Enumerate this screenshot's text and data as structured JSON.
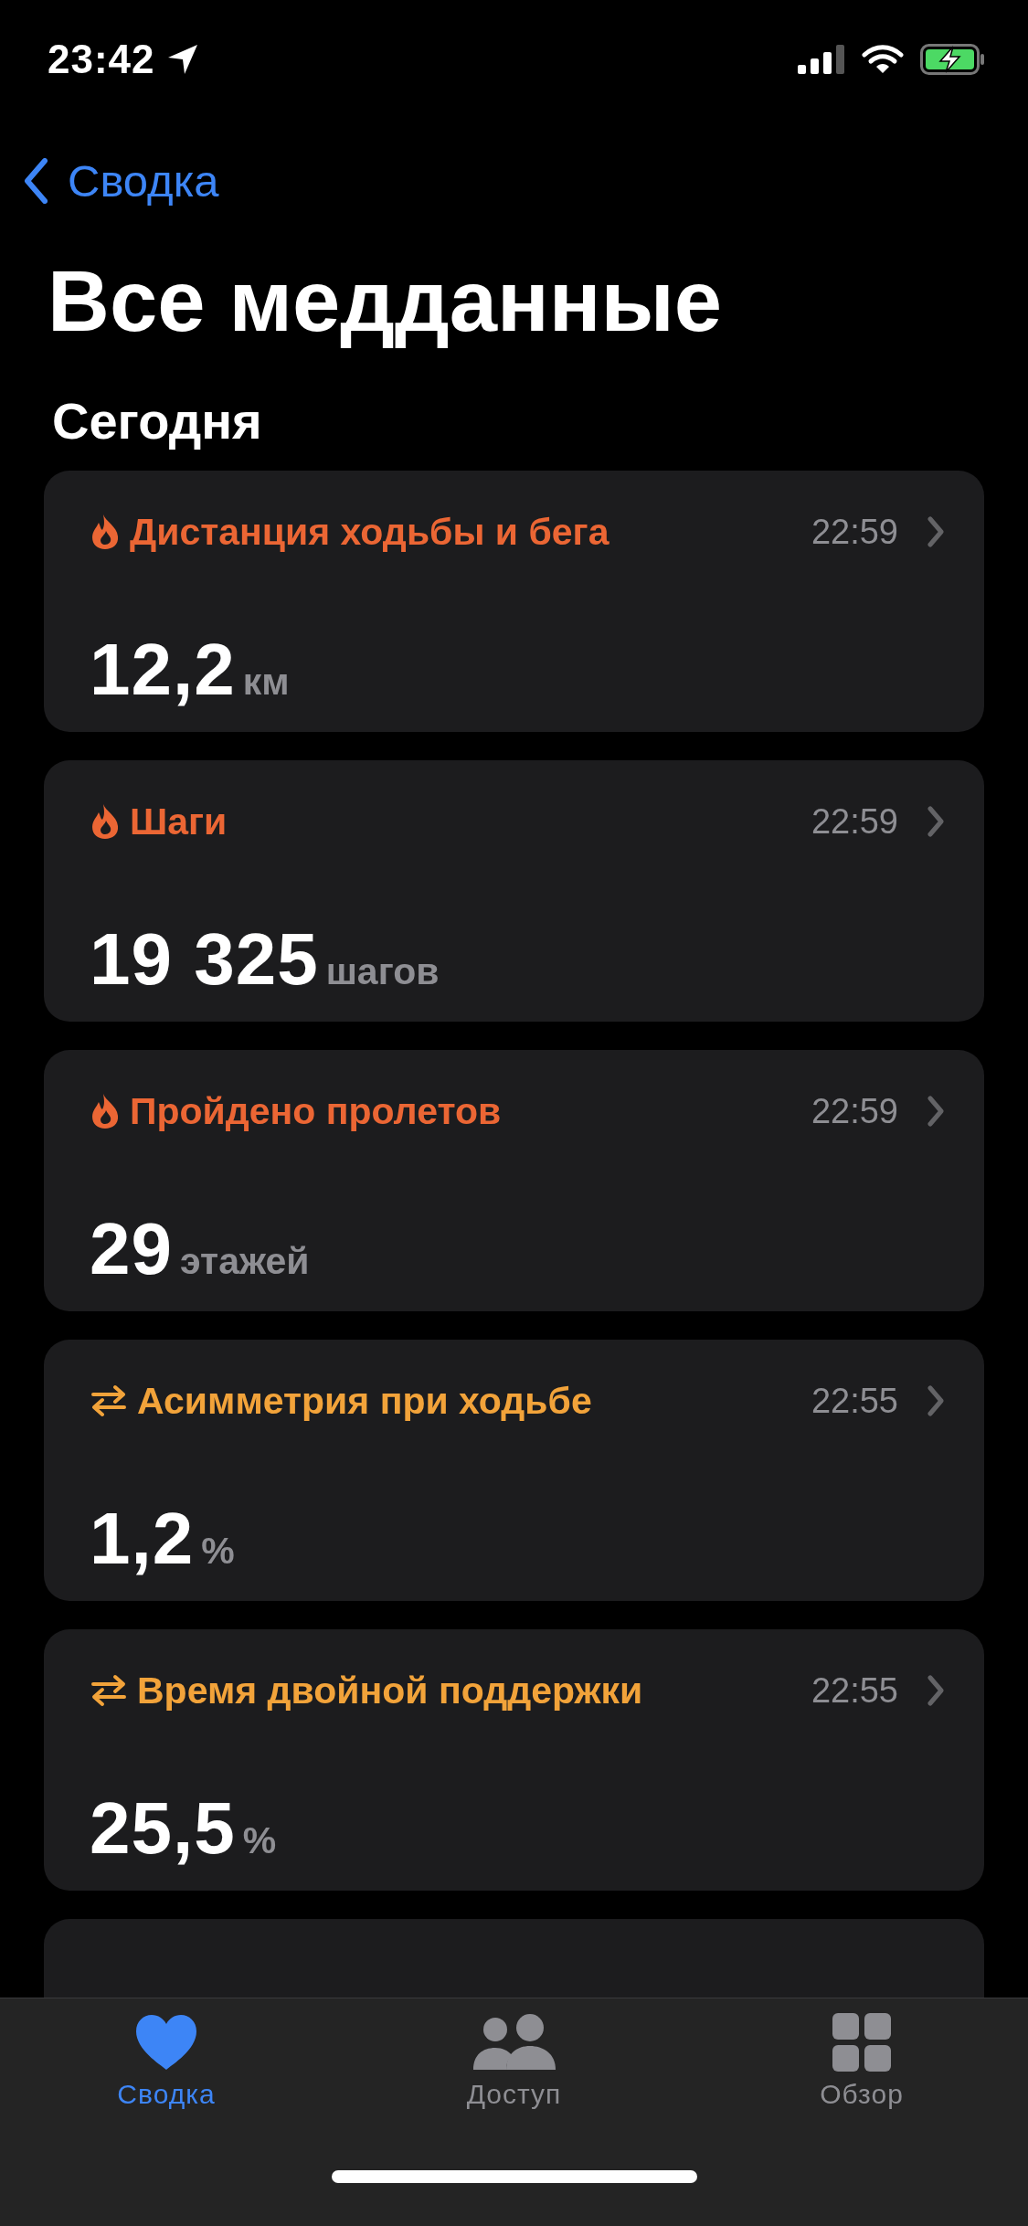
{
  "status_bar": {
    "time": "23:42"
  },
  "nav": {
    "back_label": "Сводка"
  },
  "title": "Все медданные",
  "section": "Сегодня",
  "cards": [
    {
      "kind": "activity",
      "title": "Дистанция ходьбы и бега",
      "time": "22:59",
      "value": "12,2",
      "unit": "км"
    },
    {
      "kind": "activity",
      "title": "Шаги",
      "time": "22:59",
      "value": "19 325",
      "unit": "шагов"
    },
    {
      "kind": "activity",
      "title": "Пройдено пролетов",
      "time": "22:59",
      "value": "29",
      "unit": "этажей"
    },
    {
      "kind": "mobility",
      "title": "Асимметрия при ходьбе",
      "time": "22:55",
      "value": "1,2",
      "unit": "%"
    },
    {
      "kind": "mobility",
      "title": "Время двойной поддержки",
      "time": "22:55",
      "value": "25,5",
      "unit": "%"
    }
  ],
  "tabs": [
    {
      "kind": "summary",
      "label": "Сводка",
      "selected": true
    },
    {
      "kind": "sharing",
      "label": "Доступ",
      "selected": false
    },
    {
      "kind": "browse",
      "label": "Обзор",
      "selected": false
    }
  ]
}
